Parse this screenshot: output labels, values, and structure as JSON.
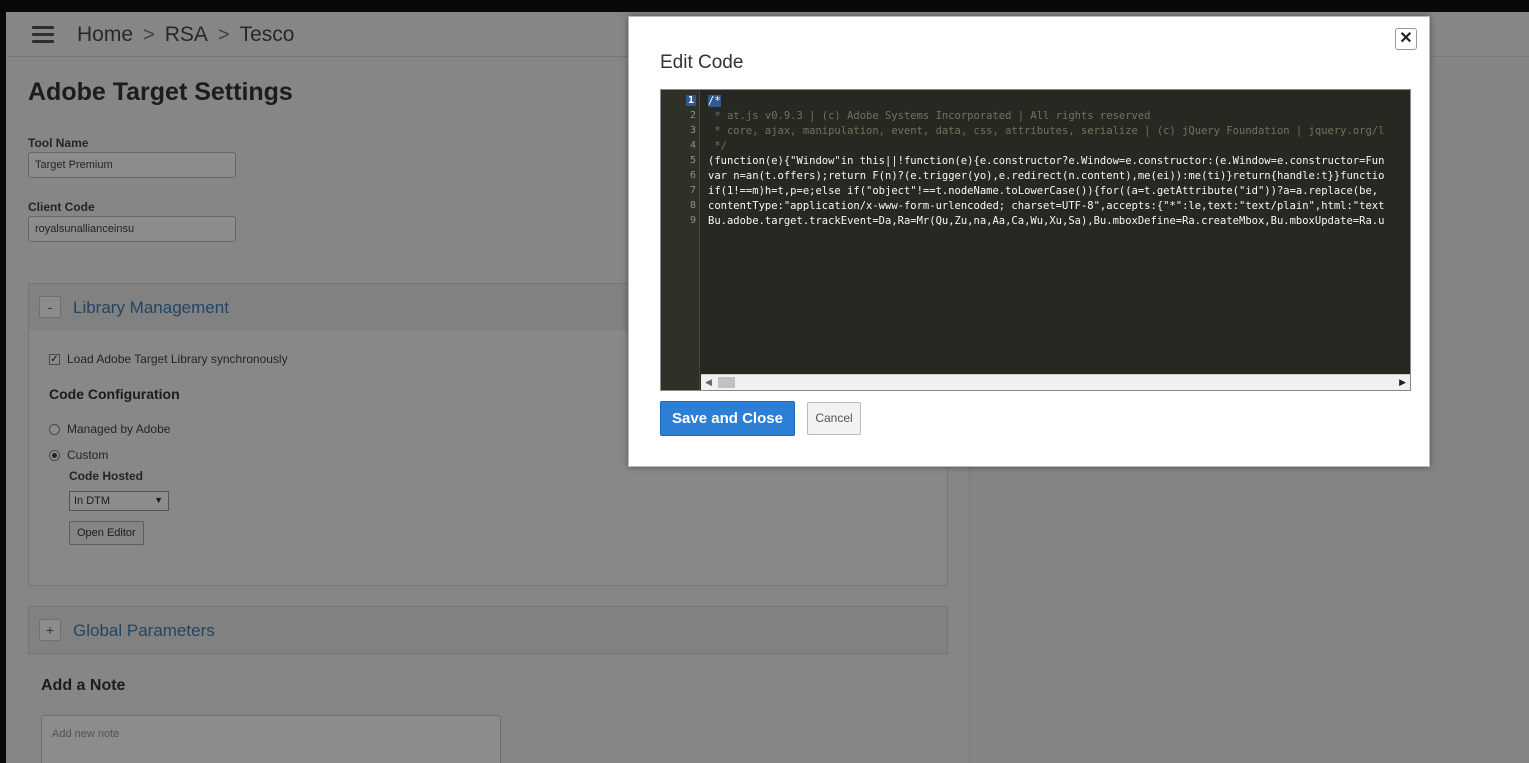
{
  "breadcrumb": {
    "items": [
      "Home",
      "RSA",
      "Tesco"
    ],
    "separator": ">"
  },
  "settings": {
    "title": "Adobe Target Settings",
    "tool_name": {
      "label": "Tool Name",
      "value": "Target Premium"
    },
    "client_code": {
      "label": "Client Code",
      "value": "royalsunallianceinsu"
    }
  },
  "library_panel": {
    "toggle": "-",
    "title": "Library Management",
    "load_sync": {
      "label": "Load Adobe Target Library synchronously",
      "checked": true
    },
    "code_config": {
      "title": "Code Configuration",
      "options": [
        {
          "label": "Managed by Adobe",
          "selected": false
        },
        {
          "label": "Custom",
          "selected": true
        }
      ],
      "code_hosted_label": "Code Hosted",
      "code_hosted_value": "In DTM",
      "open_editor": "Open Editor"
    }
  },
  "global_panel": {
    "toggle": "+",
    "title": "Global Parameters"
  },
  "note": {
    "title": "Add a Note",
    "placeholder": "Add new note"
  },
  "modal": {
    "title": "Edit Code",
    "close": "✕",
    "save": "Save and Close",
    "cancel": "Cancel",
    "editor": {
      "line_numbers": [
        "1",
        "2",
        "3",
        "4",
        "5",
        "6",
        "7",
        "8",
        "9"
      ],
      "lines": [
        "/*",
        " * at.js v0.9.3 | (c) Adobe Systems Incorporated | All rights reserved",
        " * core, ajax, manipulation, event, data, css, attributes, serialize | (c) jQuery Foundation | jquery.org/l",
        " */",
        "(function(e){\"Window\"in this||!function(e){e.constructor?e.Window=e.constructor:(e.Window=e.constructor=Fun",
        "var n=an(t.offers);return F(n)?(e.trigger(yo),e.redirect(n.content),me(ei)):me(ti)}return{handle:t}}functio",
        "if(1!==m)h=t,p=e;else if(\"object\"!==t.nodeName.toLowerCase()){for((a=t.getAttribute(\"id\"))?a=a.replace(be,",
        "contentType:\"application/x-www-form-urlencoded; charset=UTF-8\",accepts:{\"*\":le,text:\"text/plain\",html:\"text",
        "Bu.adobe.target.trackEvent=Da,Ra=Mr(Qu,Zu,na,Aa,Ca,Wu,Xu,Sa),Bu.mboxDefine=Ra.createMbox,Bu.mboxUpdate=Ra.u"
      ]
    }
  },
  "colors": {
    "accent": "#2d7fd6",
    "panel_title": "#3f7eb7",
    "editor_bg": "#272822"
  }
}
